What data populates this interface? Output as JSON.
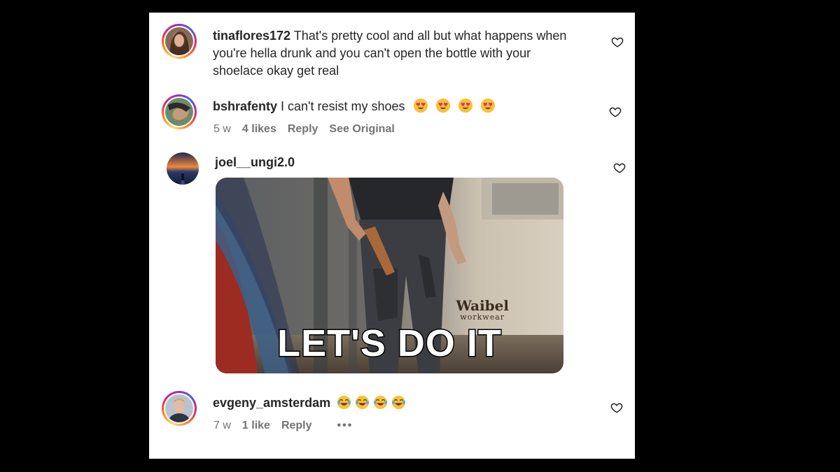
{
  "comments": [
    {
      "username": "tinaflores172",
      "text_line1": " That's pretty cool and all but what happens when",
      "text_line2": "you're hella drunk and you can't open the bottle with your",
      "text_line3": "shoelace okay get real",
      "heart_icon": "heart-outline-icon"
    },
    {
      "username": "bshrafenty",
      "text": " I can't resist my shoes",
      "emojis": [
        "smiling-face-with-heart-eyes",
        "smiling-face-with-heart-eyes",
        "smiling-face-with-heart-eyes",
        "smiling-face-with-heart-eyes"
      ],
      "time": "5 w",
      "likes": "4 likes",
      "reply": "Reply",
      "see_original": "See Original",
      "heart_icon": "heart-outline-icon"
    },
    {
      "username": "joel__ungi2.0",
      "gif": {
        "brand": "Waibel",
        "brand_sub": "workwear",
        "caption": "LET'S DO IT"
      },
      "heart_icon": "heart-outline-icon"
    },
    {
      "username": "evgeny_amsterdam",
      "emojis": [
        "face-with-tears-of-joy",
        "face-with-tears-of-joy",
        "face-with-tears-of-joy",
        "face-with-tears-of-joy"
      ],
      "time": "7 w",
      "likes": "1 like",
      "reply": "Reply",
      "more": "•••",
      "heart_icon": "heart-outline-icon"
    }
  ],
  "colors": {
    "background": "#000000",
    "panel": "#ffffff",
    "text": "#262626",
    "meta": "#737373"
  }
}
